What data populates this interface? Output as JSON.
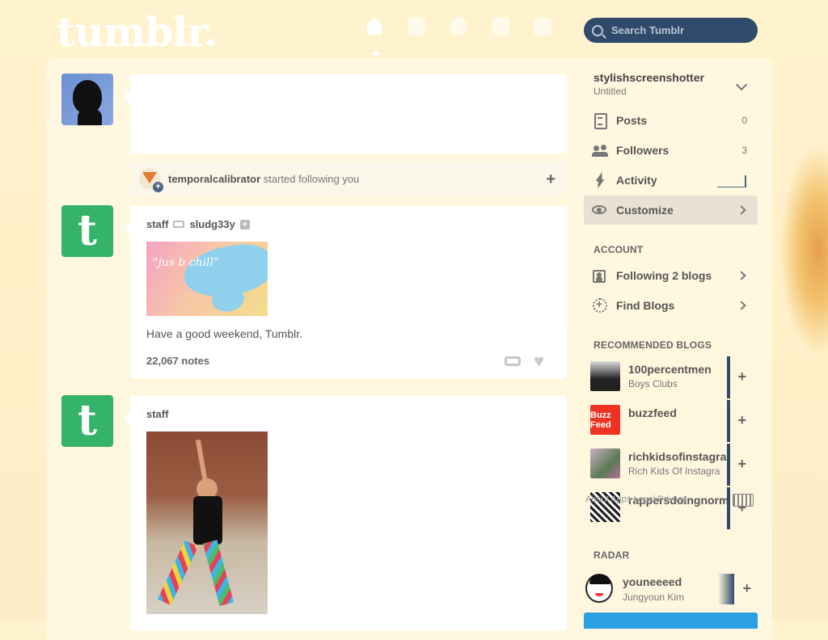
{
  "header": {
    "logo": "tumblr.",
    "nav": [
      "home-icon",
      "inbox-icon",
      "explore-icon",
      "activity-icon",
      "account-icon"
    ],
    "search_placeholder": "Search Tumblr"
  },
  "feed": {
    "follow_notice": {
      "user": "temporalcalibrator",
      "text": " started following you"
    },
    "posts": [
      {
        "author": "staff",
        "reblogged_from": "sludg33y",
        "image_text": "\"jus b chill\"",
        "caption": "Have a good weekend, Tumblr.",
        "notes": "22,067 notes"
      },
      {
        "author": "staff"
      }
    ]
  },
  "sidebar": {
    "blog_name": "stylishscreenshotter",
    "blog_subtitle": "Untitled",
    "items": [
      {
        "label": "Posts",
        "count": "0"
      },
      {
        "label": "Followers",
        "count": "3"
      },
      {
        "label": "Activity"
      },
      {
        "label": "Customize"
      }
    ],
    "account_title": "ACCOUNT",
    "account_items": [
      {
        "label": "Following 2 blogs"
      },
      {
        "label": "Find Blogs"
      }
    ],
    "recommended_title": "RECOMMENDED BLOGS",
    "recommended": [
      {
        "name": "100percentmen",
        "subtitle": "Boys Clubs"
      },
      {
        "name": "buzzfeed",
        "subtitle": ""
      },
      {
        "name": "richkidsofinstagra",
        "subtitle": "Rich Kids Of Instagra"
      },
      {
        "name": "rappersdoingnorm",
        "subtitle": ""
      }
    ],
    "footer_text": "About  Apps  Legal  Privacy",
    "radar_title": "RADAR",
    "radar": {
      "name": "youneeeed",
      "subtitle": "Jungyoun Kim"
    },
    "buzzfeed_logo": "Buzz Feed"
  },
  "colors": {
    "accent_blue": "#2f4a6a",
    "tumblr_green": "#35b36b",
    "button_blue": "#2aa0e2"
  }
}
